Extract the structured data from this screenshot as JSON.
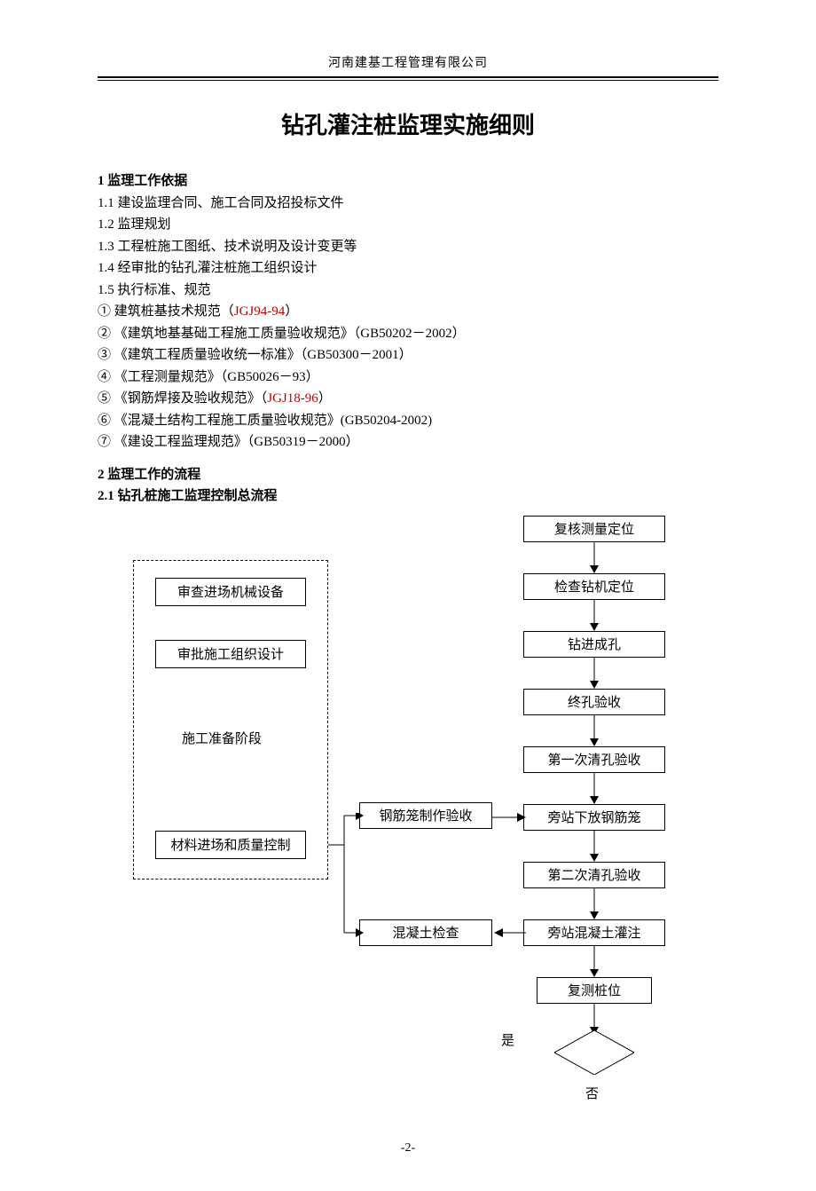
{
  "header": "河南建基工程管理有限公司",
  "title": "钻孔灌注桩监理实施细则",
  "section1_heading": "1  监理工作依据",
  "lines1": [
    "1.1   建设监理合同、施工合同及招投标文件",
    "1.2   监理规划",
    "1.3   工程桩施工图纸、技术说明及设计变更等",
    "1.4   经审批的钻孔灌注桩施工组织设计",
    "1.5   执行标准、规范"
  ],
  "std1_prefix": "①  建筑桩基技术规范（",
  "std1_red": "JGJ94-94",
  "std1_suffix": "）",
  "std2": "②  《建筑地基基础工程施工质量验收规范》（GB50202－2002）",
  "std3": "③  《建筑工程质量验收统一标准》（GB50300－2001）",
  "std4": "④  《工程测量规范》（GB50026－93）",
  "std5_prefix": "⑤  《钢筋焊接及验收规范》（",
  "std5_red": "JGJ18-96",
  "std5_suffix": "）",
  "std6": "⑥  《混凝土结构工程施工质量验收规范》(GB50204-2002)",
  "std7": "⑦  《建设工程监理规范》（GB50319－2000）",
  "section2_heading": "2  监理工作的流程",
  "section21": "2.1   钻孔桩施工监理控制总流程",
  "flow": {
    "r1": "复核测量定位",
    "r2": "检查钻机定位",
    "r3": "钻进成孔",
    "r4": "终孔验收",
    "r5": "第一次清孔验收",
    "r6": "旁站下放钢筋笼",
    "r7": "第二次清孔验收",
    "r8": "旁站混凝土灌注",
    "r9": "复测桩位",
    "l1": "审查进场机械设备",
    "l2": "审批施工组织设计",
    "l_phase": "施工准备阶段",
    "l3": "材料进场和质量控制",
    "m1": "钢筋笼制作验收",
    "m2": "混凝土检查",
    "yes": "是",
    "no": "否"
  },
  "page_no": "-2-"
}
